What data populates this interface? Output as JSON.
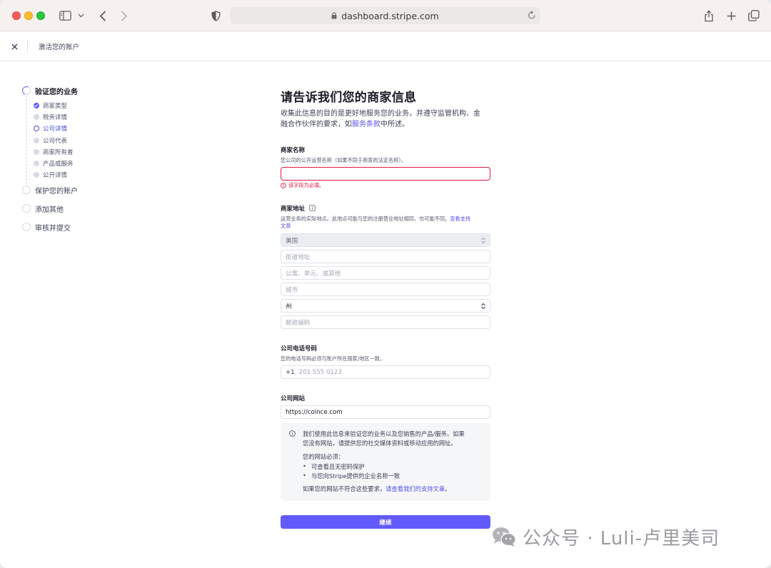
{
  "browser": {
    "url": "dashboard.stripe.com"
  },
  "header": {
    "title": "激活您的账户"
  },
  "sidebar": {
    "steps": [
      {
        "label": "验证您的业务",
        "state": "active",
        "substeps": [
          {
            "label": "商家类型",
            "state": "done"
          },
          {
            "label": "税务详情",
            "state": "todo"
          },
          {
            "label": "公司详情",
            "state": "current"
          },
          {
            "label": "公司代表",
            "state": "todo"
          },
          {
            "label": "商家所有者",
            "state": "todo"
          },
          {
            "label": "产品或服务",
            "state": "todo"
          },
          {
            "label": "公开详情",
            "state": "todo"
          }
        ]
      },
      {
        "label": "保护您的账户",
        "state": "todo"
      },
      {
        "label": "添加其他",
        "state": "todo"
      },
      {
        "label": "审核并提交",
        "state": "todo"
      }
    ]
  },
  "form": {
    "title": "请告诉我们您的商家信息",
    "intro_line1": "收集此信息的目的是更好地服务您的业务，并遵守监管机构、金",
    "intro_line2_pre": "融合作伙伴的要求，如",
    "intro_link": "服务条款",
    "intro_line2_post": "中所述。",
    "business_name": {
      "label": "商家名称",
      "help": "您公司的公开运营名称（如果不同于商家的法定名称）。",
      "value": "",
      "error": "该字段为必填。"
    },
    "business_address": {
      "label": "商家地址",
      "help_line1_pre": "运营业务的实际地点。此地点可能与您的注册营业地址相同，也可能不同。",
      "help_link": "查看支持",
      "help_link2": "文章",
      "country": "美国",
      "street_placeholder": "街道地址",
      "unit_placeholder": "公寓、单元、或其他",
      "city_placeholder": "城市",
      "state_value": "州",
      "zip_placeholder": "邮政编码"
    },
    "phone": {
      "label": "公司电话号码",
      "help": "您的电话号码必须与账户所在国家/地区一致。",
      "prefix": "+1",
      "placeholder": "201 555 0123"
    },
    "website": {
      "label": "公司网站",
      "value": "https://coince.com"
    },
    "note": {
      "line1": "我们使用此信息来验证您的业务以及您销售的产品/服务。如果",
      "line2": "您没有网站，请提供您的社交媒体资料或移动应用的网址。",
      "requirements_title": "您的网站必须：",
      "requirements": [
        "可查看且无密码保护",
        "与您向Stripe提供的企业名称一致"
      ],
      "footer_pre": "如果您的网站不符合这些要求，",
      "footer_link": "请查看我们的支持文章",
      "footer_post": "。"
    },
    "continue_label": "继续"
  },
  "watermark": {
    "text": "公众号 · Luli-卢里美司"
  },
  "colors": {
    "accent": "#625afa",
    "error": "#df1b41"
  }
}
